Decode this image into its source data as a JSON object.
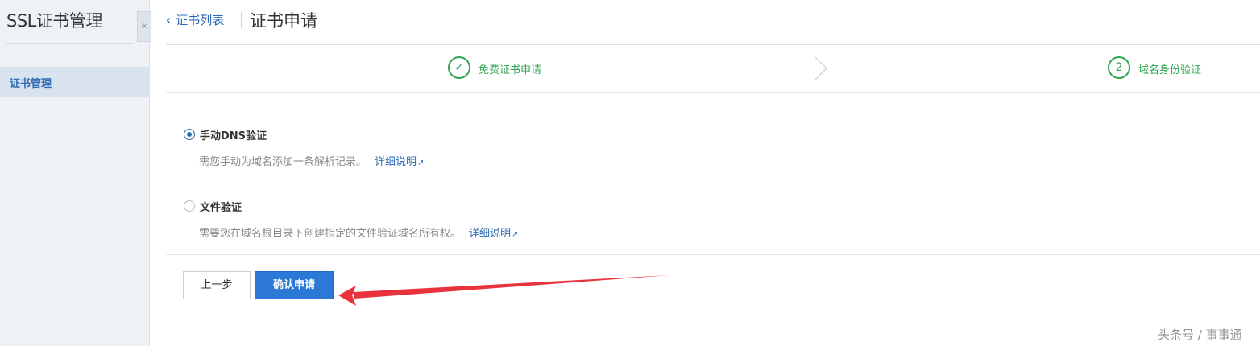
{
  "sidebar": {
    "title": "SSL证书管理",
    "collapse_glyph": "«",
    "items": [
      {
        "label": "证书管理",
        "active": true
      }
    ]
  },
  "header": {
    "back_label": "证书列表",
    "title": "证书申请"
  },
  "steps": [
    {
      "label": "免费证书申请",
      "state": "done",
      "marker": "✓"
    },
    {
      "label": "域名身份验证",
      "state": "current",
      "marker": "2"
    }
  ],
  "options": [
    {
      "title": "手动DNS验证",
      "desc": "需您手动为域名添加一条解析记录。",
      "link": "详细说明",
      "checked": true
    },
    {
      "title": "文件验证",
      "desc": "需要您在域名根目录下创建指定的文件验证域名所有权。",
      "link": "详细说明",
      "checked": false
    }
  ],
  "buttons": {
    "prev": "上一步",
    "confirm": "确认申请"
  },
  "watermark": "头条号 / 事事通",
  "colors": {
    "accent": "#2e6bb3",
    "success": "#2ea44f",
    "primary_button": "#2b78d6",
    "annotation": "#e8323c"
  }
}
